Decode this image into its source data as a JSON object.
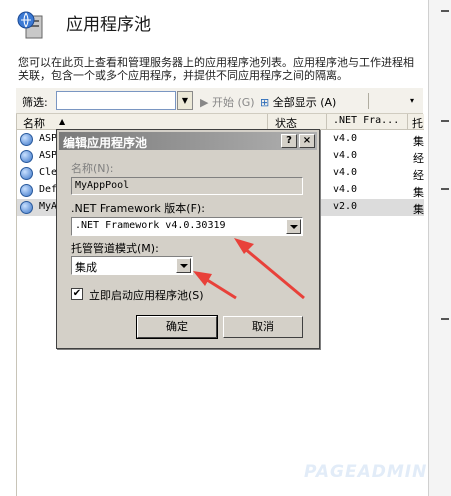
{
  "header": {
    "title": "应用程序池",
    "description": "您可以在此页上查看和管理服务器上的应用程序池列表。应用程序池与工作进程相关联，包含一个或多个应用程序，并提供不同应用程序之间的隔离。"
  },
  "toolbar": {
    "filter_label": "筛选:",
    "filter_value": "",
    "start_label": "开始 (G)",
    "show_all_label": "全部显示 (A)"
  },
  "list": {
    "columns": [
      "名称",
      "状态",
      ".NET Fra...",
      "托"
    ],
    "rows": [
      {
        "name": "ASP",
        "status": "",
        "net": "v4.0",
        "mode": "集"
      },
      {
        "name": "ASP",
        "status": "",
        "net": "v4.0",
        "mode": "经"
      },
      {
        "name": "Cle",
        "status": "",
        "net": "v4.0",
        "mode": "经"
      },
      {
        "name": "Def",
        "status": "",
        "net": "v4.0",
        "mode": "集"
      },
      {
        "name": "MyA",
        "status": "",
        "net": "v2.0",
        "mode": "集"
      }
    ]
  },
  "dialog": {
    "title": "编辑应用程序池",
    "help_label": "?",
    "close_label": "×",
    "name_label": "名称(N):",
    "name_value": "MyAppPool",
    "framework_label": ".NET Framework 版本(F):",
    "framework_value": ".NET Framework v4.0.30319",
    "pipeline_label": "托管管道模式(M):",
    "pipeline_value": "集成",
    "autostart_checked": "✔",
    "autostart_label": "立即启动应用程序池(S)",
    "ok_label": "确定",
    "cancel_label": "取消"
  },
  "watermark": "PAGEADMIN",
  "colors": {
    "annotation_arrow": "#e8413a",
    "titlebar": "#8a8a8a"
  }
}
